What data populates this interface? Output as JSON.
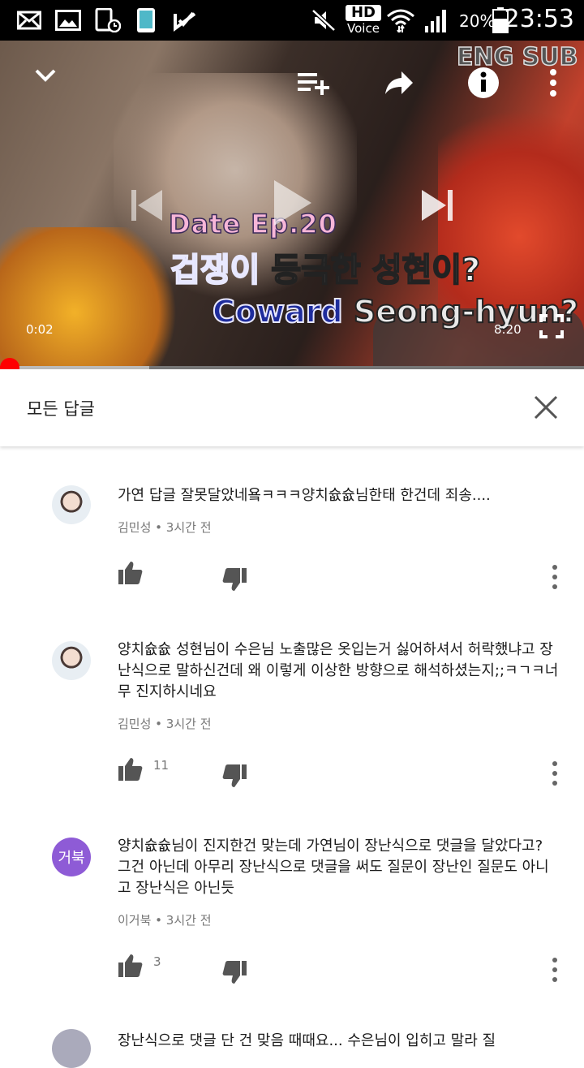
{
  "status_bar": {
    "hd_label": "HD",
    "voice_label": "Voice",
    "battery_percent": "20%",
    "time": "23:53"
  },
  "video": {
    "overlay_eng_sub": "ENG SUB",
    "overlay_title_line1": "Date Ep.20",
    "overlay_title_line2_highlight": "겁쟁이",
    "overlay_title_line2_rest": " 등극한 성현이?",
    "overlay_title_line3_highlight": "Coward",
    "overlay_title_line3_rest": " Seong-hyun?",
    "current_time": "0:02",
    "duration": "8:20",
    "progress_fraction": 0.004,
    "buffered_fraction": 0.255
  },
  "panel": {
    "title": "모든 답글"
  },
  "comments": [
    {
      "author": "김민성",
      "time": "3시간 전",
      "text": "가연 답글 잘못달았네욬ㅋㅋㅋ양치슚슚님한태 한건데 죄송....",
      "likes": "",
      "avatar_text": ""
    },
    {
      "author": "김민성",
      "time": "3시간 전",
      "text": "양치슚슚 성현님이 수은님 노출많은 옷입는거 싫어하셔서 허락했냐고 장난식으로 말하신건데 왜 이렇게 이상한 방향으로 해석하셨는지;;ㅋㄱㅋ너무 진지하시네요",
      "likes": "11",
      "avatar_text": ""
    },
    {
      "author": "이거북",
      "time": "3시간 전",
      "text": "양치슚슚님이 진지한건 맞는데 가연님이 장난식으로 댓글을 달았다고? 그건 아닌데 아무리 장난식으로 댓글을 써도 질문이 장난인 질문도 아니고 장난식은 아닌듯",
      "likes": "3",
      "avatar_text": "거북"
    }
  ],
  "partial_comment_text": "장난식으로 댓글 단 건 맞음 때때요... 수은님이 입히고 말라 질"
}
